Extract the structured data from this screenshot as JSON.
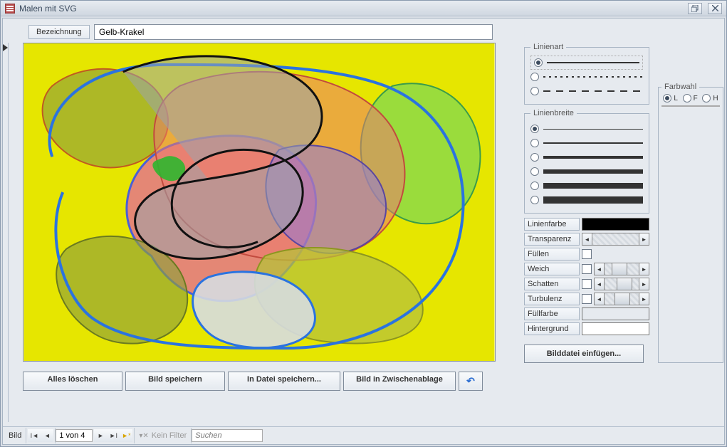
{
  "window": {
    "title": "Malen mit SVG"
  },
  "header": {
    "label_caption": "Bezeichnung",
    "name_value": "Gelb-Krakel"
  },
  "linienart": {
    "legend": "Linienart",
    "selected_index": 0
  },
  "linienbreite": {
    "legend": "Linienbreite",
    "selected_index": 0
  },
  "props": {
    "linienfarbe_label": "Linienfarbe",
    "transparenz_label": "Transparenz",
    "fuellen_label": "Füllen",
    "weich_label": "Weich",
    "schatten_label": "Schatten",
    "turbulenz_label": "Turbulenz",
    "fuellfarbe_label": "Füllfarbe",
    "hintergrund_label": "Hintergrund"
  },
  "farbwahl": {
    "legend": "Farbwahl",
    "L": "L",
    "F": "F",
    "H": "H",
    "selected": "L"
  },
  "buttons": {
    "clear": "Alles löschen",
    "save": "Bild speichern",
    "save_file": "In Datei speichern...",
    "clipboard": "Bild in Zwischenablage",
    "insert_file": "Bilddatei einfügen..."
  },
  "status": {
    "bild_label": "Bild",
    "record_counter": "1 von 4",
    "kein_filter": "Kein Filter",
    "suchen": "Suchen"
  }
}
